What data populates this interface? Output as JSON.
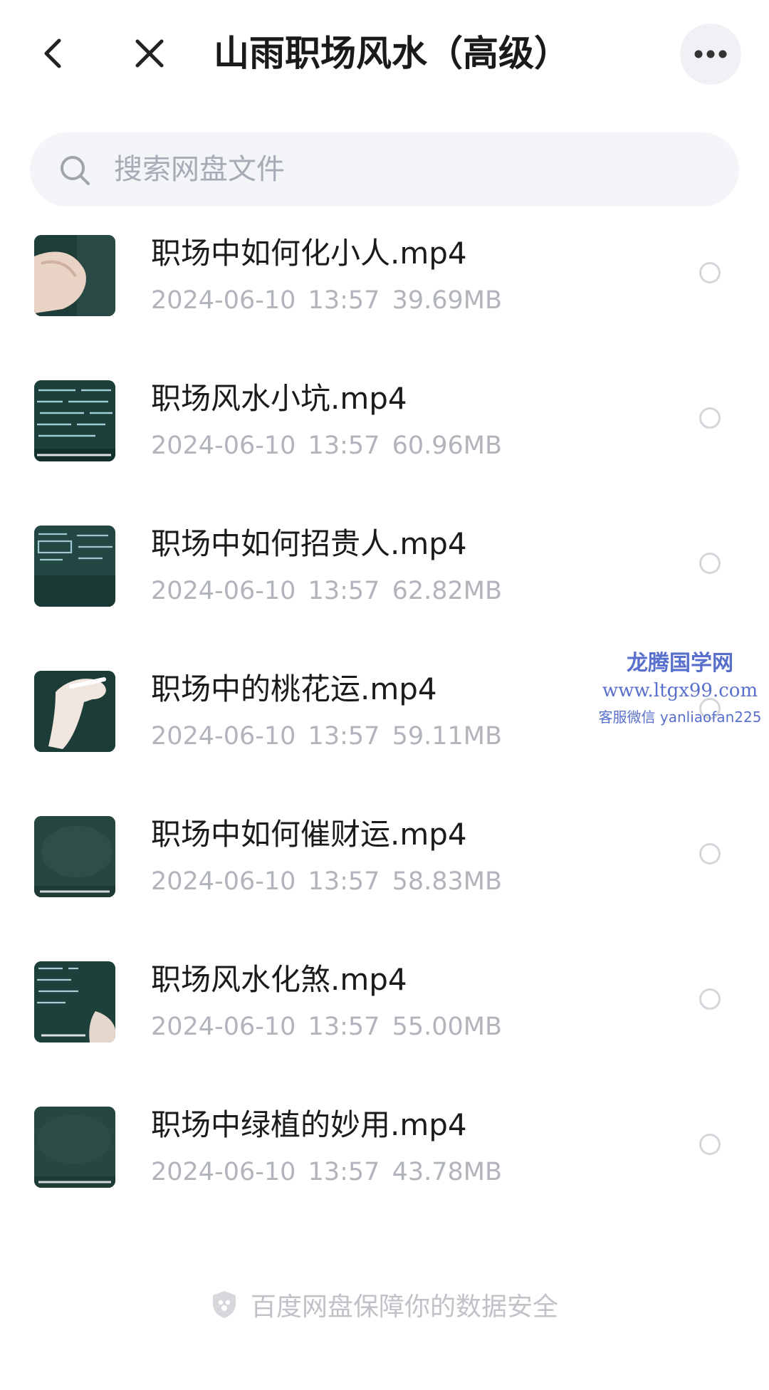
{
  "header": {
    "back_icon": "chevron-left-icon",
    "close_icon": "close-icon",
    "title": "山雨职场风水（高级）",
    "more_icon": "more-horizontal-icon"
  },
  "search": {
    "icon": "search-icon",
    "placeholder": "搜索网盘文件",
    "value": ""
  },
  "files": [
    {
      "name": "职场中如何化小人.mp4",
      "date": "2024-06-10",
      "time": "13:57",
      "size": "39.69MB",
      "selected": false
    },
    {
      "name": "职场风水小坑.mp4",
      "date": "2024-06-10",
      "time": "13:57",
      "size": "60.96MB",
      "selected": false
    },
    {
      "name": "职场中如何招贵人.mp4",
      "date": "2024-06-10",
      "time": "13:57",
      "size": "62.82MB",
      "selected": false
    },
    {
      "name": "职场中的桃花运.mp4",
      "date": "2024-06-10",
      "time": "13:57",
      "size": "59.11MB",
      "selected": false
    },
    {
      "name": "职场中如何催财运.mp4",
      "date": "2024-06-10",
      "time": "13:57",
      "size": "58.83MB",
      "selected": false
    },
    {
      "name": "职场风水化煞.mp4",
      "date": "2024-06-10",
      "time": "13:57",
      "size": "55.00MB",
      "selected": false
    },
    {
      "name": "职场中绿植的妙用.mp4",
      "date": "2024-06-10",
      "time": "13:57",
      "size": "43.78MB",
      "selected": false
    }
  ],
  "watermark": {
    "title": "龙腾国学网",
    "url": "www.ltgx99.com",
    "contact": "客服微信 yanliaofan225"
  },
  "footer": {
    "icon": "shield-icon",
    "text": "百度网盘保障你的数据安全"
  },
  "colors": {
    "text_primary": "#1b1b1b",
    "text_secondary": "#b1b4bb",
    "search_bg": "#f4f5f9",
    "watermark": "#4b63c8"
  }
}
